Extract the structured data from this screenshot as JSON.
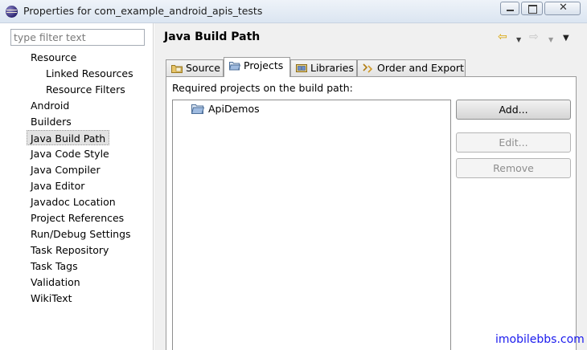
{
  "window": {
    "title": "Properties for com_example_android_apis_tests",
    "close_glyph": "✕"
  },
  "filter": {
    "placeholder": "type filter text",
    "value": ""
  },
  "tree": {
    "items": [
      {
        "label": "Resource"
      },
      {
        "label": "Linked Resources"
      },
      {
        "label": "Resource Filters"
      },
      {
        "label": "Android"
      },
      {
        "label": "Builders"
      },
      {
        "label": "Java Build Path",
        "selected": true
      },
      {
        "label": "Java Code Style"
      },
      {
        "label": "Java Compiler"
      },
      {
        "label": "Java Editor"
      },
      {
        "label": "Javadoc Location"
      },
      {
        "label": "Project References"
      },
      {
        "label": "Run/Debug Settings"
      },
      {
        "label": "Task Repository"
      },
      {
        "label": "Task Tags"
      },
      {
        "label": "Validation"
      },
      {
        "label": "WikiText"
      }
    ]
  },
  "page": {
    "title": "Java Build Path",
    "nav": {
      "back_glyph": "⇦",
      "forward_glyph": "⇨",
      "dropdown_glyph": "▼",
      "menu_glyph": "▼"
    }
  },
  "tabs": [
    {
      "label": "Source",
      "icon": "source-folder-icon"
    },
    {
      "label": "Projects",
      "icon": "project-folder-icon",
      "active": true
    },
    {
      "label": "Libraries",
      "icon": "library-icon"
    },
    {
      "label": "Order and Export",
      "icon": "order-export-icon"
    }
  ],
  "projects_tab": {
    "label": "Required projects on the build path:",
    "projects": [
      {
        "name": "ApiDemos",
        "icon": "project-folder-icon"
      }
    ],
    "buttons": {
      "add": "Add...",
      "edit": "Edit...",
      "remove": "Remove"
    }
  },
  "watermark": "imobilebbs.com",
  "colors": {
    "accent_back_arrow": "#d9a300",
    "watermark": "#1a1aee",
    "selection": "#e2e2e2"
  }
}
